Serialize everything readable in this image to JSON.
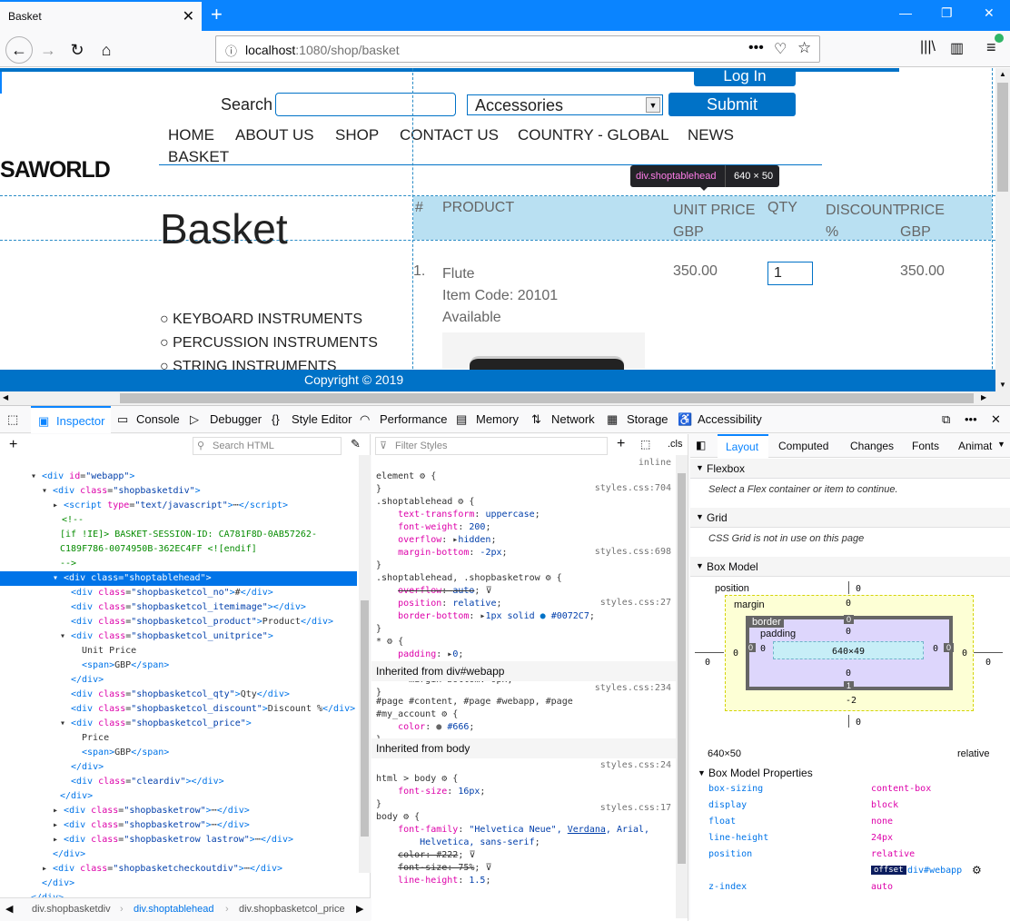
{
  "browser": {
    "tab_title": "Basket",
    "url_host": "localhost",
    "url_path": ":1080/shop/basket"
  },
  "site": {
    "login_label": "Log In",
    "search_label": "Search",
    "category_value": "Accessories",
    "submit_label": "Submit",
    "nav": [
      "HOME",
      "ABOUT US",
      "SHOP",
      "CONTACT US",
      "COUNTRY - GLOBAL",
      "NEWS",
      "BASKET"
    ],
    "logo_text": "SAWORLD",
    "page_heading": "Basket",
    "categories": [
      "KEYBOARD INSTRUMENTS",
      "PERCUSSION INSTRUMENTS",
      "STRING INSTRUMENTS"
    ],
    "copyright": "Copyright © 2019",
    "table_head": {
      "no": "#",
      "product": "PRODUCT",
      "unit_price": "UNIT PRICE",
      "unit_price_sub": "GBP",
      "qty": "QTY",
      "discount": "DISCOUNT",
      "discount_sub": "%",
      "price": "PRICE",
      "price_sub": "GBP"
    },
    "row": {
      "no": "1.",
      "product": "Flute",
      "item_code": "Item Code: 20101",
      "availability": "Available",
      "unit_price": "350.00",
      "qty": "1",
      "price": "350.00"
    },
    "tooltip": {
      "selector": "div.shoptablehead",
      "size": "640 × 50"
    }
  },
  "devtools": {
    "tabs": [
      "Inspector",
      "Console",
      "Debugger",
      "Style Editor",
      "Performance",
      "Memory",
      "Network",
      "Storage",
      "Accessibility"
    ],
    "search_html_placeholder": "Search HTML",
    "filter_styles_placeholder": "Filter Styles",
    "cls_label": ".cls",
    "layout_tabs": [
      "Layout",
      "Computed",
      "Changes",
      "Fonts",
      "Animat"
    ],
    "breadcrumbs": [
      "div.shopbasketdiv",
      "div.shoptablehead",
      "div.shopbasketcol_price"
    ],
    "flexbox_title": "Flexbox",
    "flexbox_msg": "Select a Flex container or item to continue.",
    "grid_title": "Grid",
    "grid_msg": "CSS Grid is not in use on this page",
    "boxmodel_title": "Box Model",
    "boxmodel": {
      "position": "position",
      "margin": "margin",
      "border": "border",
      "padding": "padding",
      "content": "640×49",
      "size": "640×50",
      "pos_value": "relative",
      "mb": "-2"
    },
    "bmp_title": "Box Model Properties",
    "bmp": [
      {
        "k": "box-sizing",
        "v": "content-box"
      },
      {
        "k": "display",
        "v": "block"
      },
      {
        "k": "float",
        "v": "none"
      },
      {
        "k": "line-height",
        "v": "24px"
      },
      {
        "k": "position",
        "v": "relative"
      },
      {
        "k": "z-index",
        "v": "auto"
      }
    ],
    "offset_label": "offset",
    "offset_target": "div#webapp",
    "inherited_webapp": "Inherited from div#webapp",
    "inherited_body": "Inherited from body"
  }
}
